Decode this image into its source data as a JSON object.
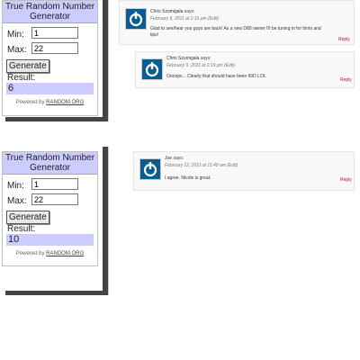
{
  "widget": {
    "title_line1": "True Random Number",
    "title_line2": "Generator",
    "min_label": "Min:",
    "max_label": "Max:",
    "generate_label": "Generate",
    "result_label": "Result:",
    "powered_by": "Powered by",
    "powered_link": "RANDOM.ORG"
  },
  "shot1": {
    "min_value": "1",
    "max_value": "22",
    "result": "6",
    "comments": [
      {
        "author": "Chris Szumigala",
        "says": "says:",
        "date": "February 9, 2011 at 2:16 pm",
        "edit": "(Edit)",
        "text_line1": "Glad to see/hear you guys are back! As a new D80 owner I'll be tuning in for hints and",
        "text_line2": "tips!",
        "reply": "Reply"
      },
      {
        "author": "Chris Szumigala",
        "says": "says:",
        "date": "February 9, 2011 at 2:19 pm",
        "edit": "(Edit)",
        "text_line1": "Oooops... Clearly that should have been 60D LOL",
        "reply": "Reply"
      }
    ]
  },
  "shot2": {
    "min_value": "1",
    "max_value": "22",
    "result": "10",
    "comments": [
      {
        "author": "Joe",
        "says": "says:",
        "date": "February 12, 2011 at 11:49 am",
        "edit": "(Edit)",
        "text_line1": "I agree. Nicole is great.",
        "reply": "Reply"
      }
    ]
  },
  "colors": {
    "accent_bg": "#ccccff",
    "avatar_bg": "#0b5d8f",
    "reply_color": "#b02020"
  },
  "icons": {
    "avatar": "power-icon"
  }
}
